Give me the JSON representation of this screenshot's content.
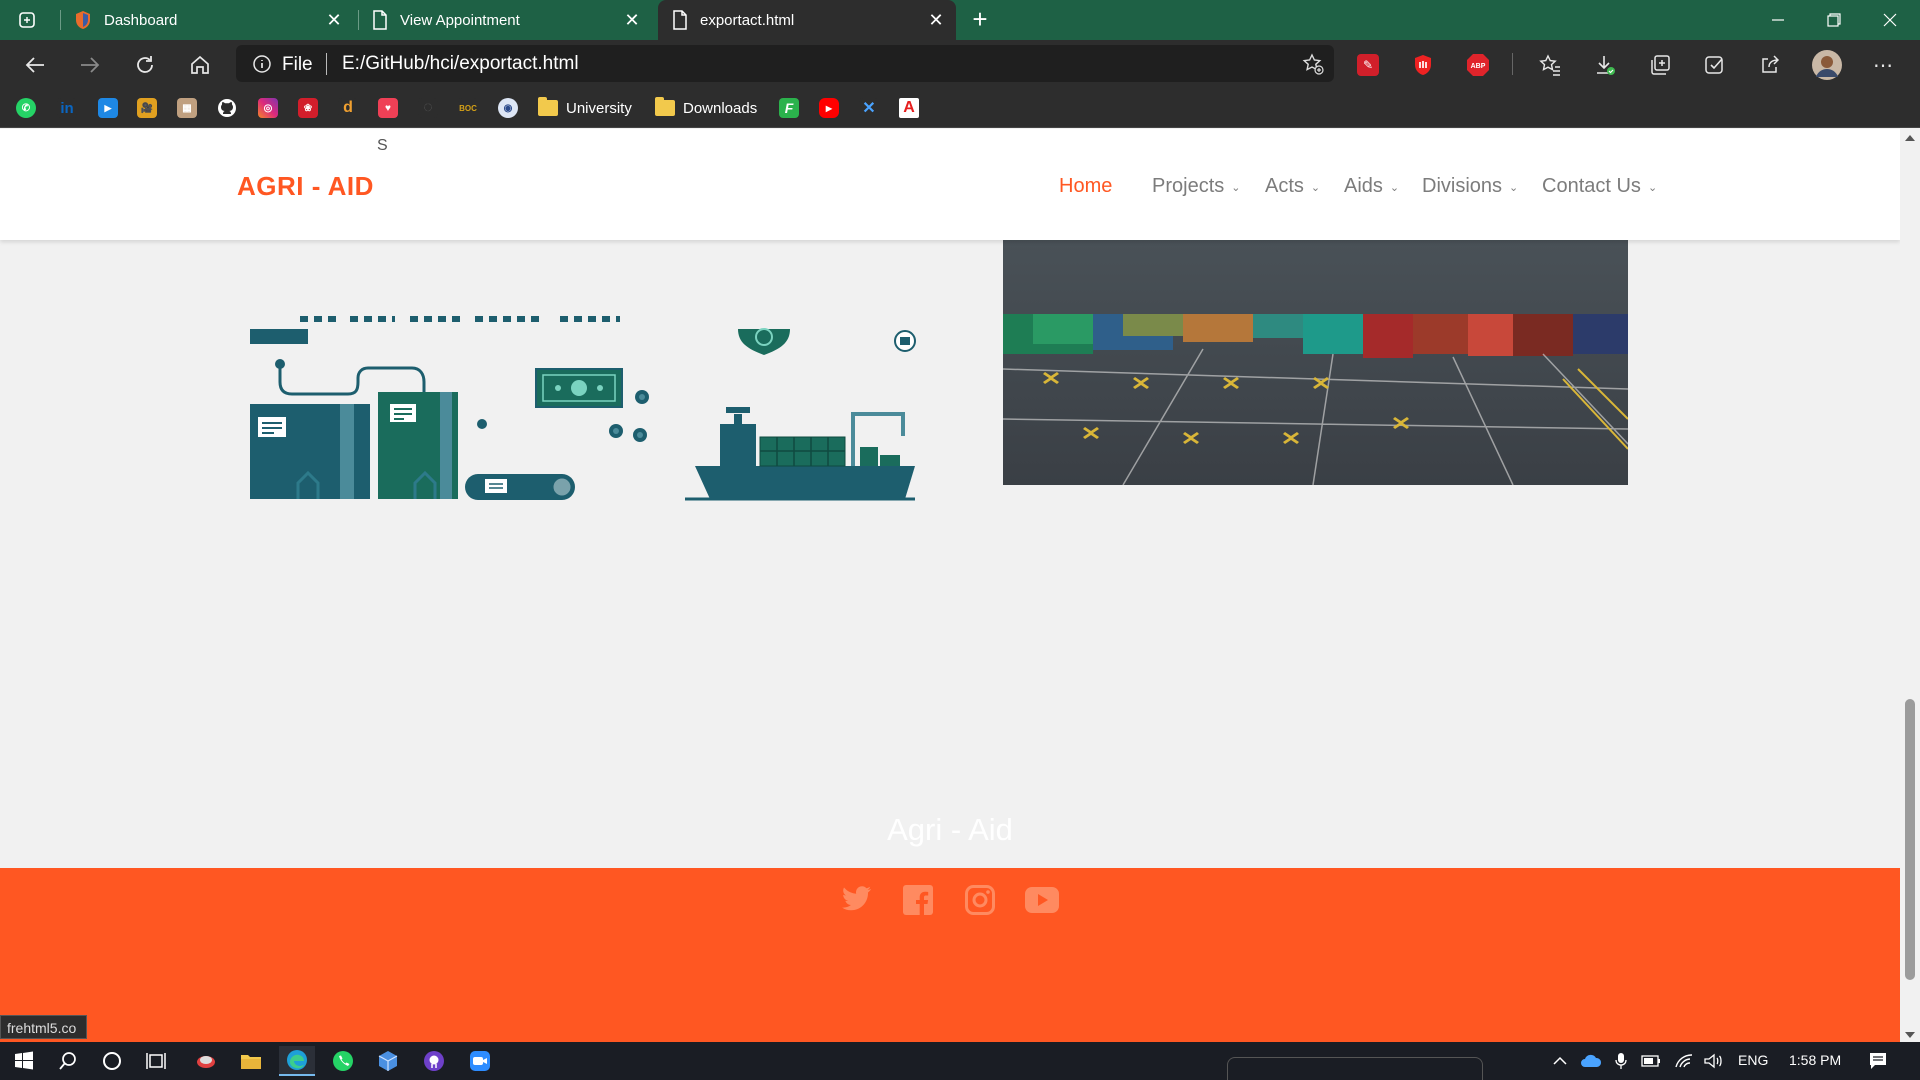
{
  "browser": {
    "tabs": [
      {
        "label": "Dashboard",
        "icon": "shield-icon"
      },
      {
        "label": "View Appointment",
        "icon": "page-icon"
      },
      {
        "label": "exportact.html",
        "icon": "page-icon"
      }
    ],
    "address": {
      "scheme_label": "File",
      "url": "E:/GitHub/hci/exportact.html"
    },
    "bookmarks": [
      {
        "label": "University",
        "type": "folder"
      },
      {
        "label": "Downloads",
        "type": "folder"
      }
    ]
  },
  "site": {
    "logo_prefix": "S",
    "logo": "AGRI - AID",
    "nav": [
      "Home",
      "Projects",
      "Acts",
      "Aids",
      "Divisions",
      "Contact Us"
    ],
    "footer_title": "Agri - Aid",
    "socials": [
      "twitter-icon",
      "facebook-icon",
      "instagram-icon",
      "youtube-icon"
    ]
  },
  "status_tip": "frehtml5.co",
  "taskbar": {
    "lang": "ENG",
    "time": "1:58 PM"
  },
  "colors": {
    "accent": "#ff5722",
    "tabbar": "#1e6145",
    "chrome": "#2d2d2d"
  }
}
